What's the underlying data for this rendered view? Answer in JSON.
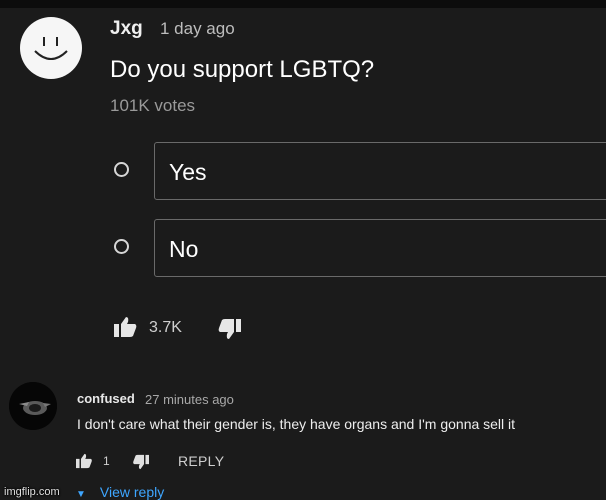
{
  "comment": {
    "author": "Jxg",
    "time": "1 day ago",
    "poll": {
      "question": "Do you support LGBTQ?",
      "votes": "101K votes",
      "options": [
        "Yes",
        "No"
      ]
    },
    "likes": "3.7K",
    "icons": {
      "avatar": "smiley-face-avatar",
      "like": "thumbs-up-icon",
      "dislike": "thumbs-down-icon",
      "radio": "radio-icon"
    }
  },
  "reply": {
    "author": "confused",
    "time": "27 minutes ago",
    "text": "I don't care what their gender is, they have organs and I'm gonna sell it",
    "likes": "1",
    "reply_label": "REPLY",
    "view_reply": "View reply",
    "icons": {
      "avatar": "dark-logo-avatar",
      "expand": "caret-down-icon"
    }
  },
  "watermark": "imgflip.com",
  "colors": {
    "background": "#1b1b1b",
    "link": "#3ea6ff",
    "muted": "#9a9a9a"
  }
}
